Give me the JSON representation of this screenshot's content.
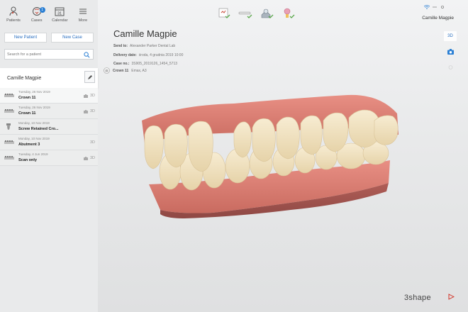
{
  "nav": {
    "patients": "Patients",
    "cases": "Cases",
    "cases_badge": "1",
    "calendar": "Calendar",
    "calendar_day": "31",
    "more": "More"
  },
  "buttons": {
    "new_patient": "New Patient",
    "new_case": "New Case"
  },
  "search": {
    "placeholder": "Search for a patient"
  },
  "patient": {
    "name": "Camille Magpie"
  },
  "cases": [
    {
      "date": "Tuesday, 26 Nov 2019",
      "title": "Crown 11",
      "view": "3D"
    },
    {
      "date": "Tuesday, 26 Nov 2019",
      "title": "Crown 11",
      "view": "3D"
    },
    {
      "date": "Monday, 10 Nov 2019",
      "title": "Screw Retained Cro...",
      "view": ""
    },
    {
      "date": "Monday, 10 Nov 2019",
      "title": "Abutment 3",
      "view": "3D"
    },
    {
      "date": "Tuesday, 4 Jun 2019",
      "title": "Scan only",
      "view": "3D"
    }
  ],
  "header": {
    "user": "Camille Magpie"
  },
  "side_tools": {
    "view_3d": "3D"
  },
  "case_info": {
    "title": "Camille Magpie",
    "send_to_label": "Send to:",
    "send_to": "Alexander Parker Dental Lab",
    "delivery_label": "Delivery date:",
    "delivery": "środa, 4 grudnia 2019 10:00",
    "case_no_label": "Case no.:",
    "case_no": "3S905_2019126_1454_5713",
    "crown_label": "Crown 11",
    "crown_material": "Emax, A3"
  },
  "brand": "3shape",
  "colors": {
    "accent": "#2a7fd4",
    "gum": "#e2877a",
    "tooth": "#f1e4c4"
  },
  "icons": [
    "patients-icon",
    "cases-icon",
    "calendar-icon",
    "more-icon",
    "search-icon",
    "edit-icon",
    "camera-icon",
    "wifi-icon"
  ]
}
